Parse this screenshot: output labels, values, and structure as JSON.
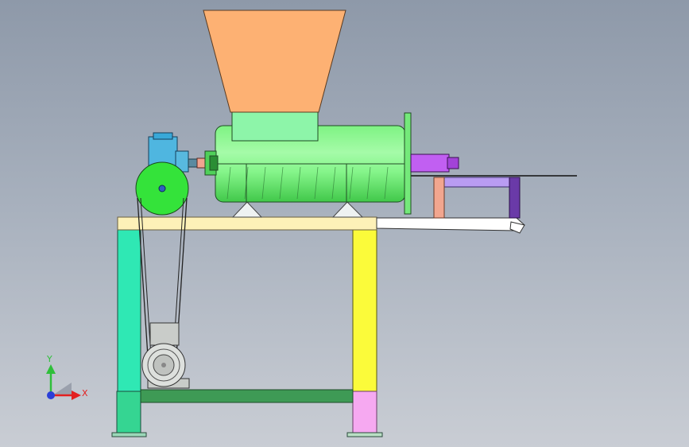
{
  "triad": {
    "y_label": "Y",
    "x_label": "X",
    "y_color": "#2fbf3a",
    "x_color": "#e32020",
    "origin_color": "#2a3fd8"
  },
  "colors": {
    "hopper": "#fdb173",
    "barrel": "#86f58b",
    "feed_box": "#8df5a9",
    "gearbox": "#4fb6e0",
    "pulley": "#34e33a",
    "coupling": "#f0a490",
    "outlet_motor": "#c15ff2",
    "side_frame": "#b99cf2",
    "side_leg_left": "#f2a68f",
    "side_leg_right": "#6a3aa8",
    "top_beam": "#fdf1b8",
    "left_leg": "#2fe8b4",
    "right_leg": "#fbfb3a",
    "left_foot_block": "#35d592",
    "right_foot_block": "#f6a9f1",
    "bottom_beam": "#3e9a55",
    "motor": "#cfd3cf",
    "chute": "#ffffff"
  }
}
